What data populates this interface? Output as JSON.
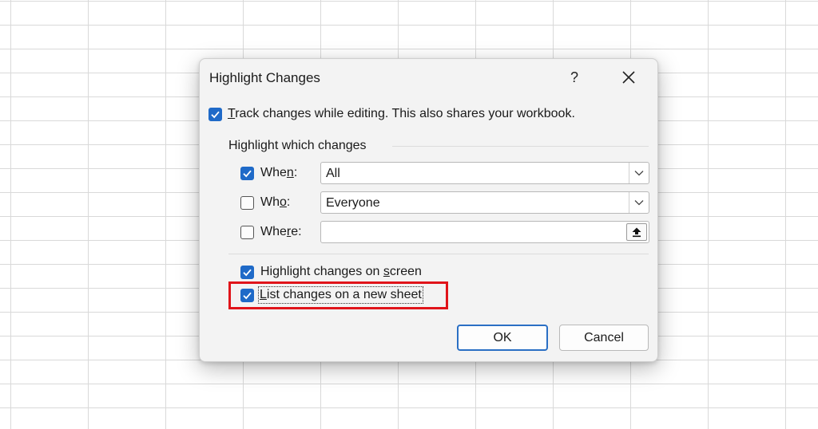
{
  "dialog": {
    "title": "Highlight Changes",
    "help_label": "?",
    "track_changes": {
      "checked": true,
      "pre": "",
      "accel": "T",
      "post": "rack changes while editing. This also shares your workbook."
    },
    "group_title": "Highlight which changes",
    "when": {
      "checked": true,
      "pre": "Whe",
      "accel": "n",
      "post": ":",
      "value": "All"
    },
    "who": {
      "checked": false,
      "pre": "Wh",
      "accel": "o",
      "post": ":",
      "value": "Everyone"
    },
    "where": {
      "checked": false,
      "pre": "Whe",
      "accel": "r",
      "post": "e:",
      "value": ""
    },
    "highlight_on_screen": {
      "checked": true,
      "pre": "Highlight changes on ",
      "accel": "s",
      "post": "creen"
    },
    "list_on_new_sheet": {
      "checked": true,
      "pre": "",
      "accel": "L",
      "post": "ist changes on a new sheet"
    },
    "ok_label": "OK",
    "cancel_label": "Cancel"
  },
  "colors": {
    "accent": "#1f6ac8",
    "highlight_border": "#e0141a"
  },
  "icons": {
    "help": "question-mark",
    "close": "close-x",
    "dropdown": "chevron-down",
    "collapse": "collapse-upload-arrow"
  }
}
